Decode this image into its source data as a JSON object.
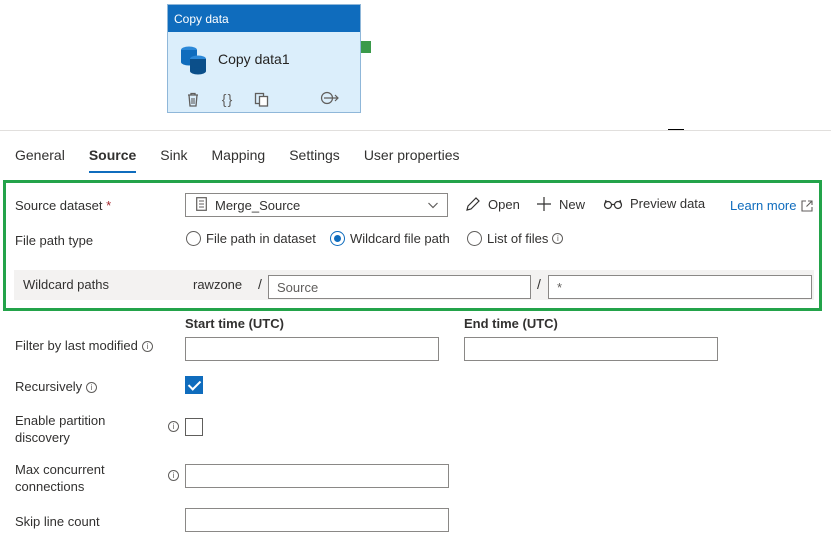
{
  "activity": {
    "header": "Copy data",
    "name": "Copy data1"
  },
  "tabs": [
    {
      "label": "General",
      "active": false
    },
    {
      "label": "Source",
      "active": true
    },
    {
      "label": "Sink",
      "active": false
    },
    {
      "label": "Mapping",
      "active": false
    },
    {
      "label": "Settings",
      "active": false
    },
    {
      "label": "User properties",
      "active": false
    }
  ],
  "source": {
    "dataset_label": "Source dataset",
    "required_mark": "*",
    "dataset_value": "Merge_Source",
    "open_label": "Open",
    "new_label": "New",
    "preview_label": "Preview data",
    "learn_more_label": "Learn more",
    "file_path_type_label": "File path type",
    "file_path_options": [
      {
        "label": "File path in dataset",
        "selected": false
      },
      {
        "label": "Wildcard file path",
        "selected": true
      },
      {
        "label": "List of files",
        "selected": false
      }
    ],
    "wildcard_label": "Wildcard paths",
    "wildcard_container": "rawzone",
    "path_separator": "/",
    "wildcard_folder": "Source",
    "wildcard_file": "*"
  },
  "filter": {
    "label": "Filter by last modified",
    "start_label": "Start time (UTC)",
    "end_label": "End time (UTC)",
    "start_value": "",
    "end_value": ""
  },
  "recursively": {
    "label": "Recursively",
    "checked": true
  },
  "partition": {
    "label_line1": "Enable partition",
    "label_line2": "discovery",
    "checked": false
  },
  "max_connections": {
    "label_line1": "Max concurrent",
    "label_line2": "connections",
    "value": ""
  },
  "skip_lines": {
    "label": "Skip line count",
    "value": ""
  },
  "colors": {
    "accent": "#0f6cbd",
    "highlight": "#23a34a",
    "card": "#dbeefb"
  }
}
